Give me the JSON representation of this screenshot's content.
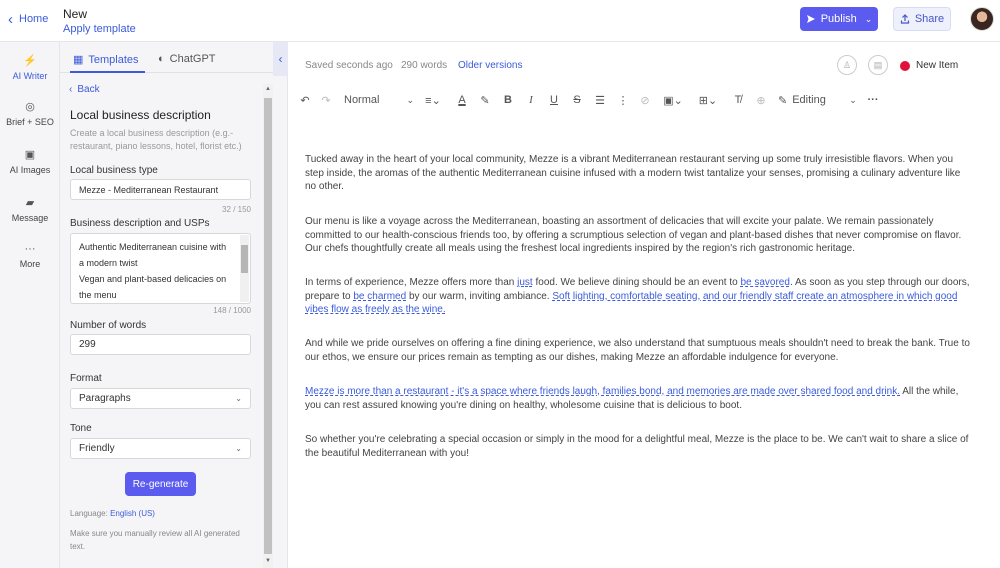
{
  "header": {
    "home_label": "Home",
    "doc_title": "New",
    "apply_template": "Apply template",
    "publish_label": "Publish",
    "share_label": "Share"
  },
  "leftnav": {
    "items": [
      {
        "label": "AI Writer",
        "icon": "lightning-icon"
      },
      {
        "label": "Brief + SEO",
        "icon": "target-icon"
      },
      {
        "label": "AI Images",
        "icon": "image-icon"
      },
      {
        "label": "Message",
        "icon": "message-icon"
      },
      {
        "label": "More",
        "icon": "more-icon"
      }
    ]
  },
  "panel": {
    "tabs": [
      "Templates",
      "ChatGPT"
    ],
    "back_label": "Back",
    "title": "Local business description",
    "description": "Create a local business description (e.g.- restaurant, piano lessons, hotel, florist etc.)",
    "business_type_label": "Local business type",
    "business_type_value": "Mezze - Mediterranean Restaurant",
    "business_type_counter": "32 / 150",
    "usp_label": "Business description and USPs",
    "usp_lines": [
      "Authentic Mediterranean cuisine with",
      "a modern twist",
      "Vegan and plant-based delicacies on",
      "the menu"
    ],
    "usp_counter": "148 / 1000",
    "words_label": "Number of words",
    "words_value": "299",
    "format_label": "Format",
    "format_value": "Paragraphs",
    "tone_label": "Tone",
    "tone_value": "Friendly",
    "regenerate_label": "Re-generate",
    "language_prefix": "Language:",
    "language_value": "English (US)",
    "review_note": "Make sure you manually review all AI generated text."
  },
  "editor": {
    "saved_status": "Saved seconds ago",
    "word_count": "290 words",
    "older_versions": "Older versions",
    "new_item_label": "New Item",
    "style_select": "Normal",
    "mode_select": "Editing",
    "paragraphs": [
      {
        "parts": [
          {
            "t": "Tucked away in the heart of your local community, Mezze is a vibrant Mediterranean restaurant serving up some truly irresistible flavors. When you step inside, the aromas of the authentic Mediterranean cuisine infused with a modern twist tantalize your senses, promising a culinary adventure like no other."
          }
        ]
      },
      {
        "parts": [
          {
            "t": "Our menu is like a voyage across the Mediterranean, boasting an assortment of delicacies that will excite your palate. We remain passionately committed to our health-conscious friends too, by offering a scrumptious selection of vegan and plant-based dishes that never compromise on flavor. Our chefs thoughtfully create all meals using the freshest local ingredients inspired by the region's rich gastronomic heritage."
          }
        ]
      },
      {
        "parts": [
          {
            "t": "In terms of experience, Mezze offers more than "
          },
          {
            "t": "just",
            "u": true
          },
          {
            "t": " food. We believe dining should be an event to "
          },
          {
            "t": "be savored",
            "u": true
          },
          {
            "t": ". As soon as you step through our doors, prepare to "
          },
          {
            "t": "be charmed",
            "u": true
          },
          {
            "t": " by our warm, inviting ambiance. "
          },
          {
            "t": "Soft lighting, comfortable seating, and our friendly staff create an atmosphere in which good vibes flow as freely as the wine.",
            "u": true
          }
        ]
      },
      {
        "parts": [
          {
            "t": "And while we pride ourselves on offering a fine dining experience, we also understand that sumptuous meals shouldn't need to break the bank. True to our ethos, we ensure our prices remain as tempting as our dishes, making Mezze an affordable indulgence for everyone."
          }
        ]
      },
      {
        "parts": [
          {
            "t": "Mezze is more than a restaurant - it's a space where friends laugh, families bond, and memories are made over shared food and drink.",
            "u": true
          },
          {
            "t": " All the while, you can rest assured knowing you're dining on healthy, wholesome cuisine that is delicious to boot."
          }
        ]
      },
      {
        "parts": [
          {
            "t": "So whether you're celebrating a special occasion or simply in the mood for a delightful meal, Mezze is the place to be. We can't wait to share a slice of the beautiful Mediterranean with you!"
          }
        ]
      }
    ]
  }
}
